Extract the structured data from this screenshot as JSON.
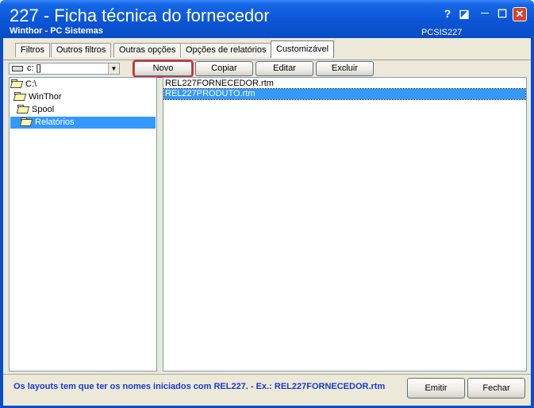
{
  "window": {
    "title": "227 - Ficha técnica do fornecedor",
    "subtitle": "Winthor - PC Sistemas",
    "code": "PCSIS227",
    "controls": {
      "help": "?",
      "restore": "◪",
      "minimize": "—",
      "maximize": "☐",
      "close": "✕"
    }
  },
  "tabs": [
    {
      "label": "Filtros"
    },
    {
      "label": "Outros filtros"
    },
    {
      "label": "Outras opções"
    },
    {
      "label": "Opções de relatórios"
    },
    {
      "label": "Customizável"
    }
  ],
  "active_tab": "Customizável",
  "drive_select": {
    "value": "c: []"
  },
  "toolbar": {
    "novo": "Novo",
    "copiar": "Copiar",
    "editar": "Editar",
    "excluir": "Excluir"
  },
  "tree": [
    {
      "label": "C:\\"
    },
    {
      "label": "WinThor"
    },
    {
      "label": "Spool"
    },
    {
      "label": "Relatórios"
    }
  ],
  "files": [
    {
      "name": "REL227FORNECEDOR.rtm"
    },
    {
      "name": "REL227PRODUTO.rtm"
    }
  ],
  "footer": {
    "info": "Os layouts tem que ter os nomes iniciados com REL227.  - Ex.: REL227FORNECEDOR.rtm",
    "emitir": "Emitir",
    "fechar": "Fechar"
  },
  "colors": {
    "title_bar": "#0b55d6",
    "selection": "#3399ff",
    "info_text": "#1a3cc9",
    "highlight_border": "#e8252a"
  }
}
